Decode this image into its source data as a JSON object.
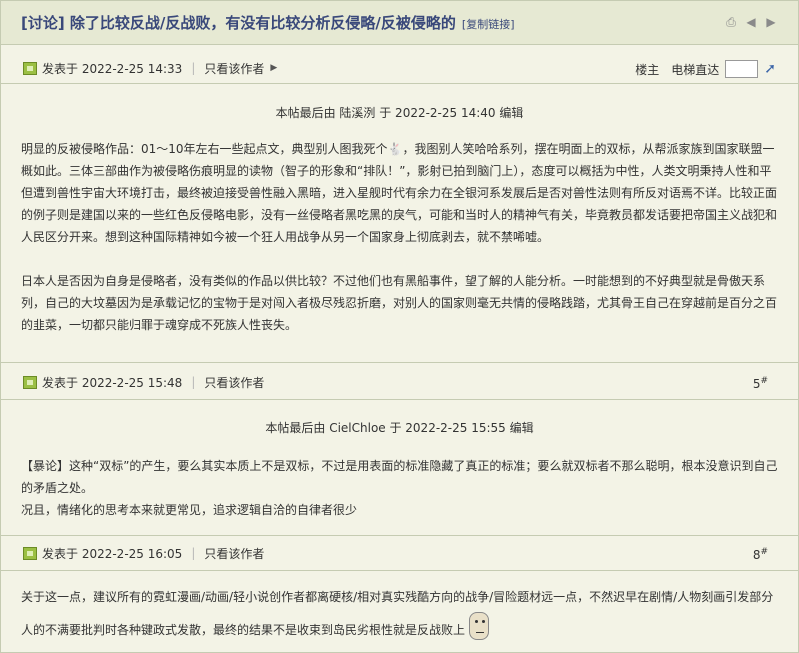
{
  "thread": {
    "title": "[讨论] 除了比较反战/反战败，有没有比较分析反侵略/反被侵略的",
    "copy_link": "[复制链接]"
  },
  "top_tools": {
    "lz": "楼主",
    "elevator": "电梯直达"
  },
  "posts": [
    {
      "posted": "发表于 2022-2-25 14:33",
      "only_author": "只看该作者",
      "edited": "本帖最后由 陆溪洌 于 2022-2-25 14:40 编辑",
      "p1a": "明显的反被侵略作品：01～10年左右一些起点文，典型别人图我死个",
      "p1b": "，我图别人笑哈哈系列，摆在明面上的双标，从帮派家族到国家联盟一概如此。三体三部曲作为被侵略伤痕明显的读物（智子的形象和“排队！”，影射已拍到脑门上），态度可以概括为中性，人类文明秉持人性和平但遭到兽性宇宙大环境打击，最终被迫接受兽性融入黑暗，进入星舰时代有余力在全银河系发展后是否对兽性法则有所反对语焉不详。比较正面的例子则是建国以来的一些红色反侵略电影，没有一丝侵略者黑吃黑的戾气，可能和当时人的精神气有关，毕竟教员都发话要把帝国主义战犯和人民区分开来。想到这种国际精神如今被一个狂人用战争从另一个国家身上彻底剥去，就不禁唏嘘。",
      "p2": "日本人是否因为自身是侵略者，没有类似的作品以供比较？不过他们也有黑船事件，望了解的人能分析。一时能想到的不好典型就是骨傲天系列，自己的大坟墓因为是承载记忆的宝物于是对闯入者极尽残忍折磨，对别人的国家则毫无共情的侵略践踏，尤其骨王自己在穿越前是百分之百的韭菜，一切都只能归罪于魂穿成不死族人性丧失。"
    },
    {
      "posted": "发表于 2022-2-25 15:48",
      "only_author": "只看该作者",
      "floor": "5",
      "floor_mark": "#",
      "edited": "本帖最后由 CielChloe 于 2022-2-25 15:55 编辑",
      "p1": "【暴论】这种“双标”的产生，要么其实本质上不是双标，不过是用表面的标准隐藏了真正的标准；要么就双标者不那么聪明，根本没意识到自己的矛盾之处。",
      "p2": "况且，情绪化的思考本来就更常见，追求逻辑自洽的自律者很少"
    },
    {
      "posted": "发表于 2022-2-25 16:05",
      "only_author": "只看该作者",
      "floor": "8",
      "floor_mark": "#",
      "p1": "关于这一点，建议所有的霓虹漫画/动画/轻小说创作者都离硬核/相对真实残酷方向的战争/冒险题材远一点，不然迟早在剧情/人物刻画引发部分人的不满要批判时各种键政式发散，最终的结果不是收束到岛民劣根性就是反战败上"
    }
  ]
}
